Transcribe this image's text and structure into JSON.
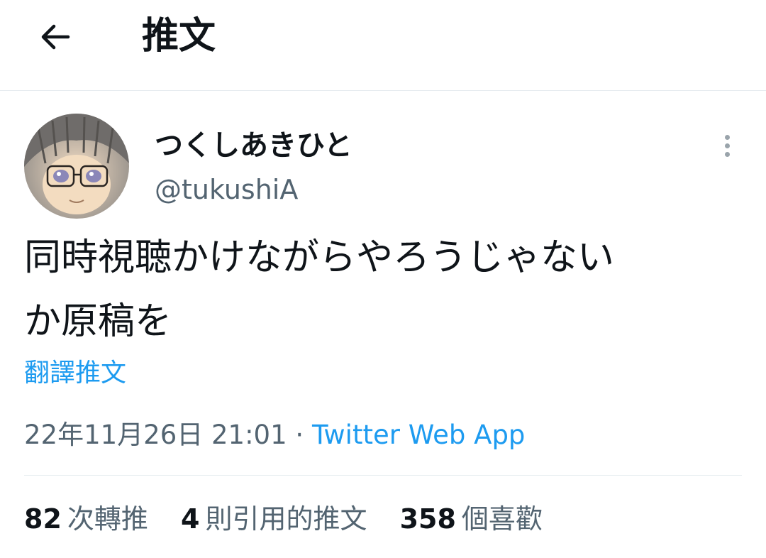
{
  "header": {
    "title": "推文",
    "back_icon": "arrow-left-icon"
  },
  "tweet": {
    "author": {
      "display_name": "つくしあきひと",
      "handle": "@tukushiA"
    },
    "text_line1": "同時視聴かけながらやろうじゃない",
    "text_line2": "か原稿を",
    "translate_label": "翻譯推文",
    "timestamp": "22年11月26日 21:01",
    "separator": "·",
    "source": "Twitter Web App",
    "more_icon": "more-vertical-icon"
  },
  "stats": {
    "retweets": {
      "count": "82",
      "label": "次轉推"
    },
    "quotes": {
      "count": "4",
      "label": "則引用的推文"
    },
    "likes": {
      "count": "358",
      "label": "個喜歡"
    }
  },
  "colors": {
    "accent": "#1d9bf0",
    "text_primary": "#0f1419",
    "text_secondary": "#536471",
    "divider": "#e6ecf0"
  }
}
